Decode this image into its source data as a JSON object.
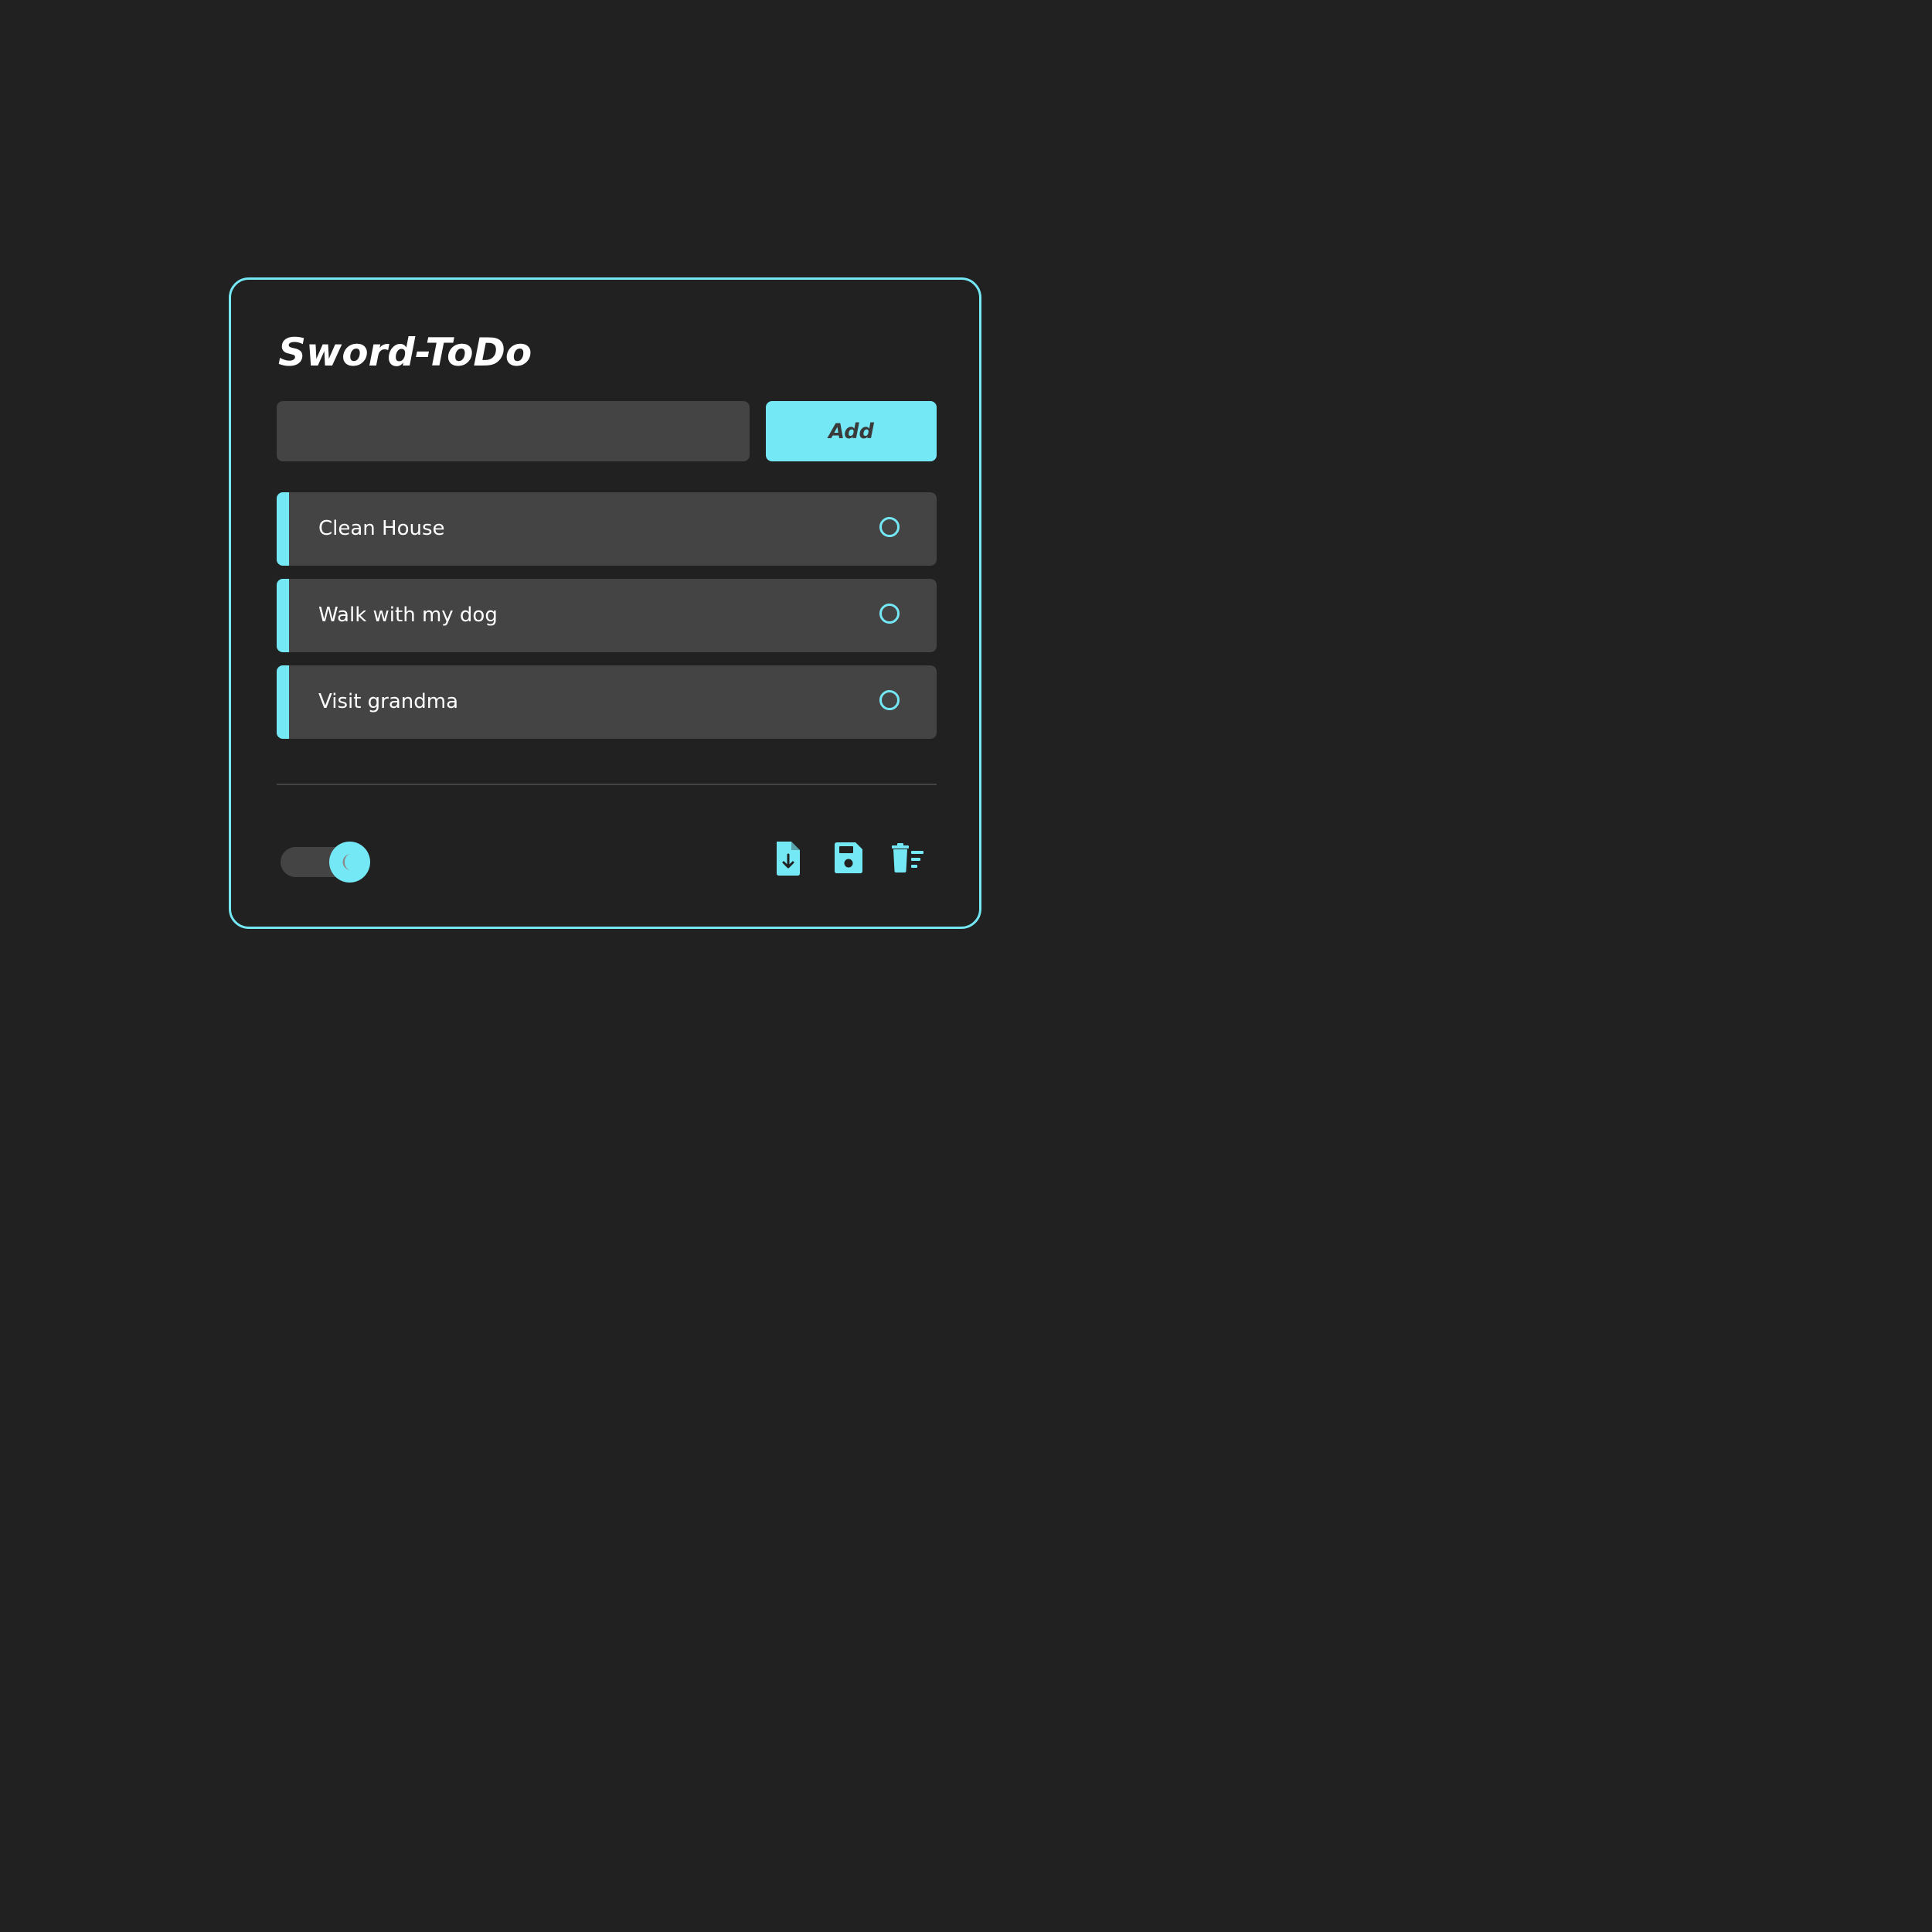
{
  "app": {
    "title": "Sword-ToDo"
  },
  "input": {
    "value": "",
    "placeholder": ""
  },
  "add_button": {
    "label": "Add"
  },
  "todos": [
    {
      "text": "Clean House",
      "done": false
    },
    {
      "text": "Walk with my dog",
      "done": false
    },
    {
      "text": "Visit grandma",
      "done": false
    }
  ],
  "footer": {
    "theme_toggle": {
      "state": "dark",
      "icon": "moon-icon"
    },
    "actions": [
      {
        "name": "download-file-button",
        "icon": "file-download-icon"
      },
      {
        "name": "save-button",
        "icon": "floppy-disk-icon"
      },
      {
        "name": "clear-all-button",
        "icon": "trash-list-icon"
      }
    ]
  },
  "colors": {
    "background": "#212121",
    "accent": "#75e8f6",
    "surface": "#444444",
    "text": "#ffffff",
    "button_text": "#3a3a3a"
  }
}
